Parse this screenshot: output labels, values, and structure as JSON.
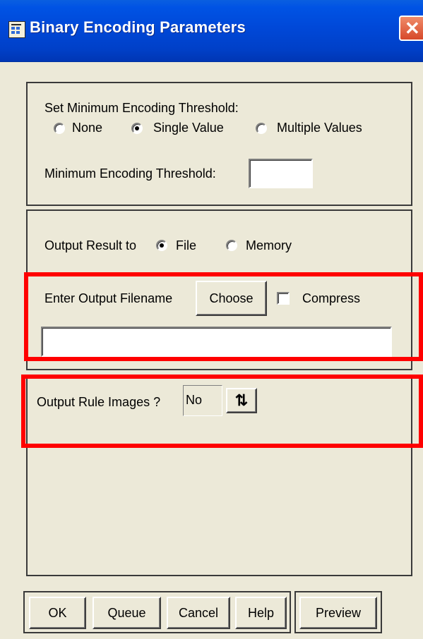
{
  "window": {
    "title": "Binary Encoding Parameters",
    "close_glyph": "✕",
    "icon": "app-window-icon"
  },
  "threshold_group": {
    "heading": "Set Minimum Encoding Threshold:",
    "options": [
      "None",
      "Single Value",
      "Multiple Values"
    ],
    "selected": "Single Value",
    "field_label": "Minimum Encoding Threshold:",
    "field_value": ""
  },
  "output_group": {
    "label": "Output Result to",
    "options": [
      "File",
      "Memory"
    ],
    "selected": "File",
    "filename_label": "Enter Output Filename",
    "choose_label": "Choose",
    "compress_label": "Compress",
    "compress_checked": false,
    "filename_value": ""
  },
  "rule_images": {
    "label": "Output Rule Images ?",
    "value": "No",
    "toggle_glyph": "⇅"
  },
  "buttons": {
    "ok": "OK",
    "queue": "Queue",
    "cancel": "Cancel",
    "help": "Help",
    "preview": "Preview"
  },
  "highlight_color": "#FF0000"
}
